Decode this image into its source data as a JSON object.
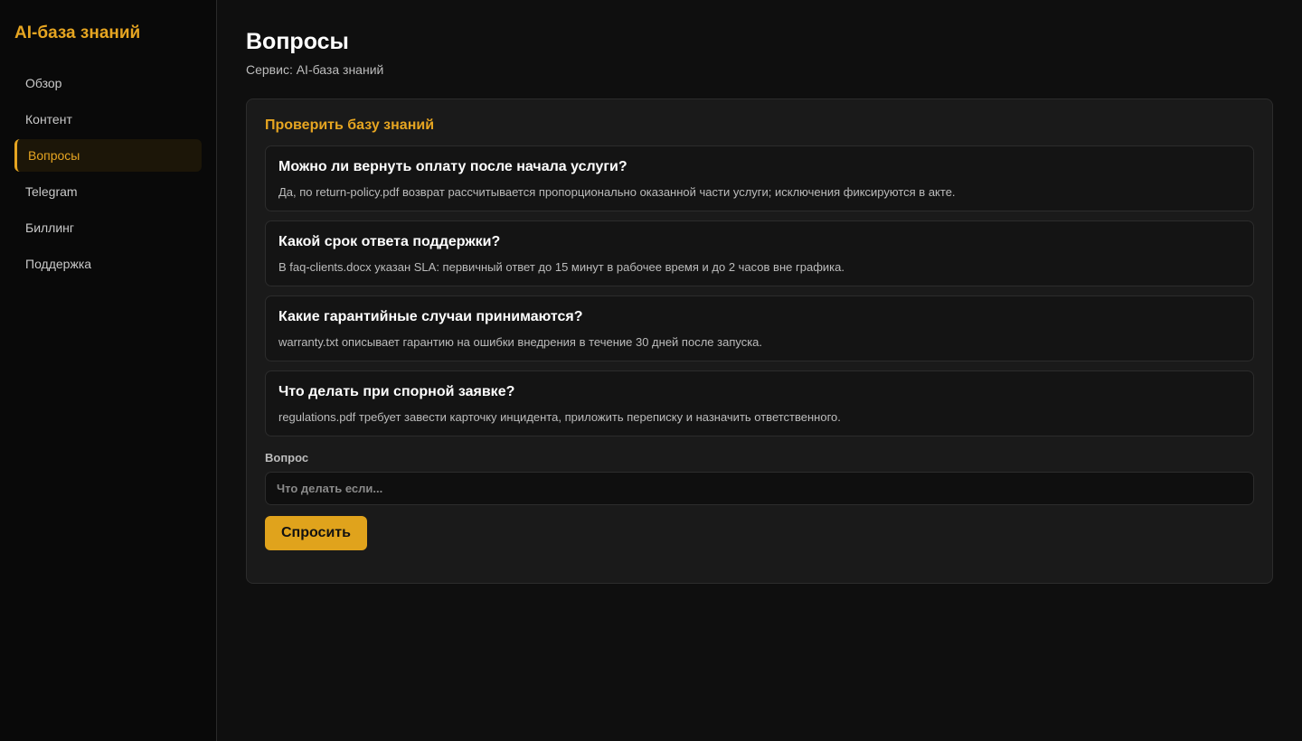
{
  "sidebar": {
    "brand": "AI-база знаний",
    "items": [
      {
        "label": "Обзор"
      },
      {
        "label": "Контент"
      },
      {
        "label": "Вопросы"
      },
      {
        "label": "Telegram"
      },
      {
        "label": "Биллинг"
      },
      {
        "label": "Поддержка"
      }
    ],
    "active_index": 2
  },
  "header": {
    "title": "Вопросы",
    "subtitle": "Сервис: AI-база знаний"
  },
  "panel": {
    "title": "Проверить базу знаний",
    "qa": [
      {
        "question": "Можно ли вернуть оплату после начала услуги?",
        "answer": "Да, по return-policy.pdf возврат рассчитывается пропорционально оказанной части услуги; исключения фиксируются в акте."
      },
      {
        "question": "Какой срок ответа поддержки?",
        "answer": "В faq-clients.docx указан SLA: первичный ответ до 15 минут в рабочее время и до 2 часов вне графика."
      },
      {
        "question": "Какие гарантийные случаи принимаются?",
        "answer": "warranty.txt описывает гарантию на ошибки внедрения в течение 30 дней после запуска."
      },
      {
        "question": "Что делать при спорной заявке?",
        "answer": "regulations.pdf требует завести карточку инцидента, приложить переписку и назначить ответственного."
      }
    ],
    "input_label": "Вопрос",
    "input_placeholder": "Что делать если...",
    "input_value": "",
    "ask_label": "Спросить"
  },
  "colors": {
    "accent": "#e6a521",
    "background": "#0f0f0f",
    "sidebar": "#090909",
    "panel": "#1a1a1a"
  }
}
